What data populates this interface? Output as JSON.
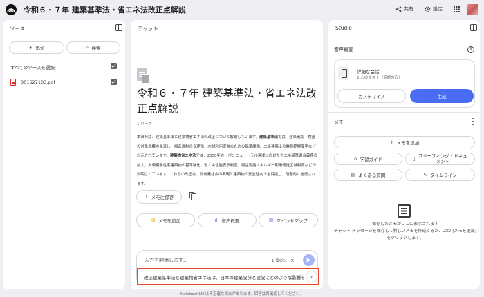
{
  "app": {
    "title": "令和６・７年 建築基準法・省エネ法改正点解説"
  },
  "topbar": {
    "share_label": "共有",
    "settings_label": "設定"
  },
  "sources": {
    "header": "ソース",
    "add_label": "追加",
    "search_label": "検索",
    "select_all_label": "すべてのソースを選択",
    "items": [
      {
        "name": "001627103.pdf"
      }
    ]
  },
  "chat": {
    "header": "チャット",
    "title": "令和６・７年 建築基準法・省エネ法改正点解説",
    "source_count": "1 ソース",
    "summary_parts": [
      {
        "text": "本資料は、建築基準法と建築物省エネ法の改正について解説しています。",
        "bold": false
      },
      {
        "text": "建築基準法",
        "bold": true
      },
      {
        "text": "では、建築確認・検査の対象規模の見直し、構造規制の合理化、木材利用促進のための基準緩和、二級建築士の業務範囲変更などが示されています。",
        "bold": false
      },
      {
        "text": "建築物省エネ法",
        "bold": true
      },
      {
        "text": "では、2050年カーボンニュートラル達成に向けた省エネ基準適合義務の拡大、大規模非住宅建築物の基準強化、省エネ性能表示制度、再生可能エネルギー利用促進区域制度などが説明されています。これらの改正は、脱炭素社会の実現と建築物の安全性向上を目指し、段階的に施行されます。",
        "bold": false
      }
    ],
    "save_note_label": "メモに保存",
    "actions": {
      "add_note": "メモを追加",
      "audio_overview": "音声概要",
      "mind_map": "マインドマップ"
    },
    "input": {
      "placeholder": "入力を開始します...",
      "source_count": "1 個のソース"
    },
    "suggestion": "改正建築基準法と建築物省エネ法は、日本の建築設計と建設にどのような影響を与えますか？"
  },
  "studio": {
    "header": "Studio",
    "audio_section": "音声概要",
    "audio_card": {
      "title": "詳細な会話",
      "subtitle": "2 人のホスト（英語のみ）",
      "customize_label": "カスタマイズ",
      "generate_label": "生成"
    },
    "notes_section": "メモ",
    "add_note_label": "メモを追加",
    "note_actions": {
      "study_guide": "学習ガイド",
      "briefing_doc": "ブリーフィング・ドキュメント",
      "faq": "よくある質問",
      "timeline": "タイムライン"
    },
    "empty_text": "保存したメモがここに表示されます\nチャット メッセージを保存して新しいメモを作成するか、上の [メモを追加] をクリックします。"
  },
  "footer": {
    "disclaimer": "NotebookLM は不正確な場合があります。回答は再確認してください。"
  },
  "colors": {
    "accent": "#4a6cf2",
    "highlight_border": "#e8452f",
    "background": "#efeff3"
  }
}
